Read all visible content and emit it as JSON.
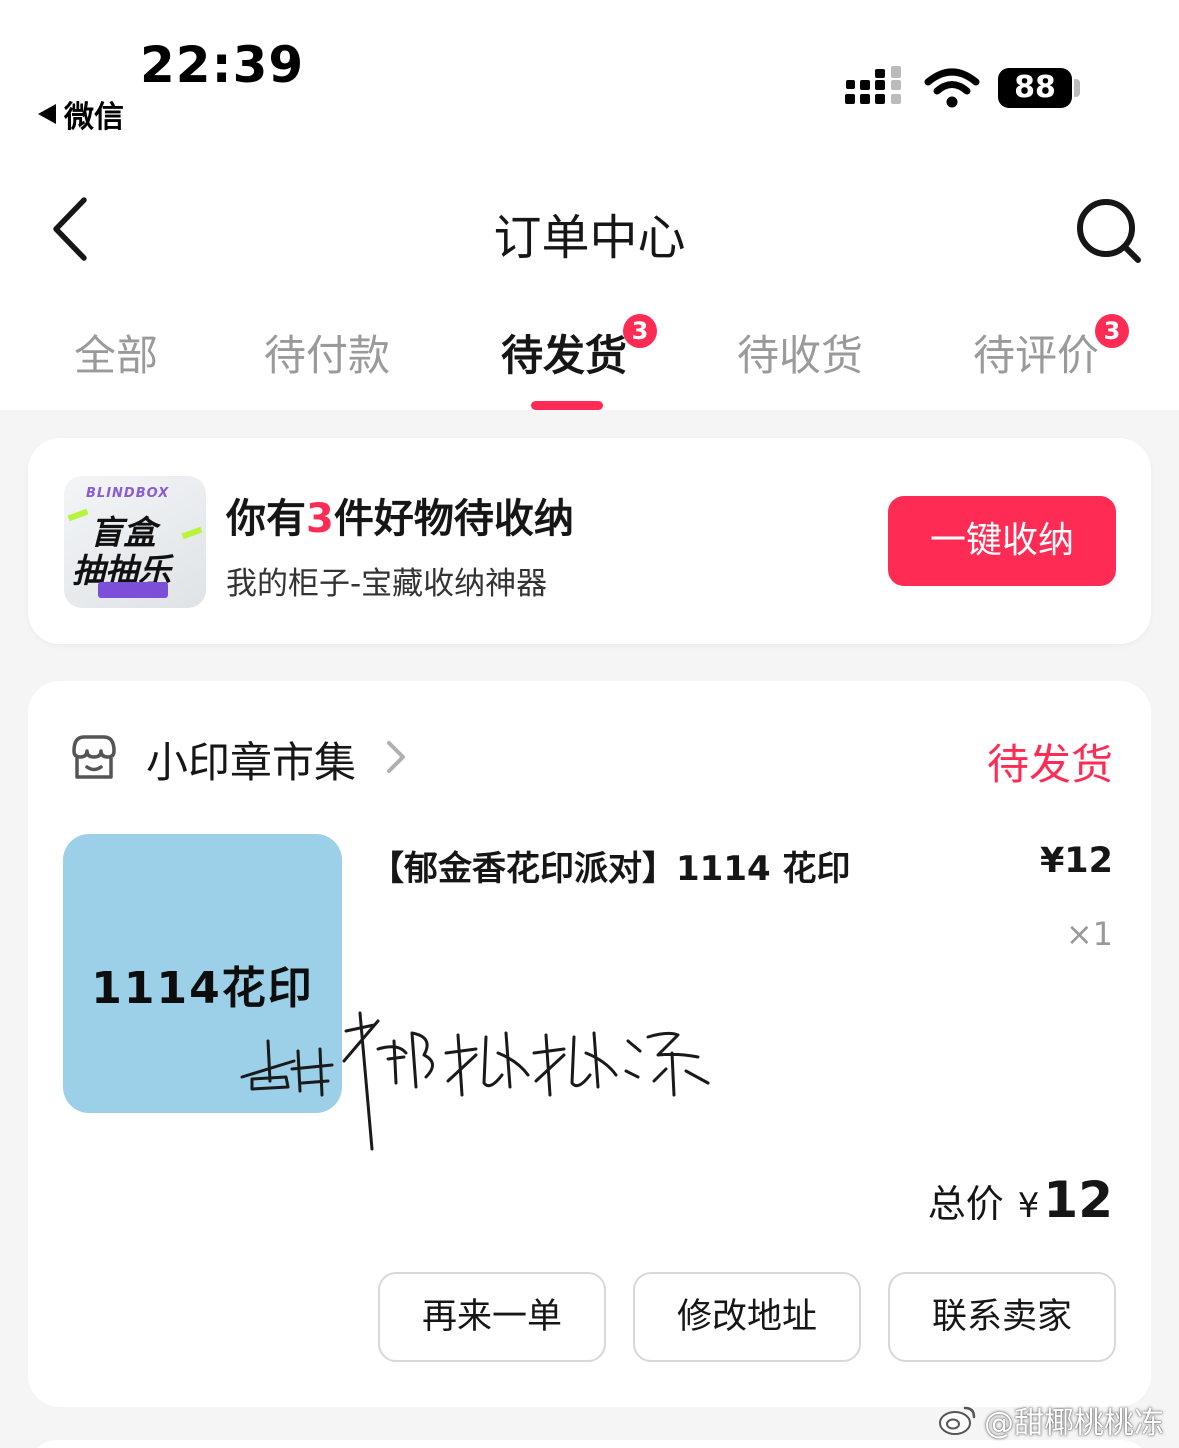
{
  "status_bar": {
    "time": "22:39",
    "back_app": "微信",
    "battery": "88"
  },
  "nav": {
    "title": "订单中心",
    "back_icon": "chevron-left-icon",
    "search_icon": "search-icon"
  },
  "tabs": [
    {
      "label": "全部",
      "badge": null,
      "active": false
    },
    {
      "label": "待付款",
      "badge": null,
      "active": false
    },
    {
      "label": "待发货",
      "badge": "3",
      "active": true
    },
    {
      "label": "待收货",
      "badge": null,
      "active": false
    },
    {
      "label": "待评价",
      "badge": "3",
      "active": false
    }
  ],
  "promo": {
    "logo_brand": "BLINDBOX",
    "logo_line1": "盲盒",
    "logo_line2": "抽抽乐",
    "title_pre": "你有",
    "title_num": "3",
    "title_post": "件好物待收纳",
    "subtitle": "我的柜子-宝藏收纳神器",
    "button": "一键收纳"
  },
  "order": {
    "shop_name": "小印章市集",
    "status": "待发货",
    "product_image_text": "1114花印",
    "product_title": "【郁金香花印派对】1114 花印",
    "price": "¥12",
    "quantity": "×1",
    "total_label": "总价",
    "total_currency": "¥",
    "total_amount": "12",
    "buttons": [
      "再来一单",
      "修改地址",
      "联系卖家"
    ]
  },
  "signature_text": "甜椰桃桃冻",
  "watermark": "@甜椰桃桃冻",
  "colors": {
    "accent": "#fe2c55",
    "product_bg": "#9bd0e8",
    "page_bg": "#f5f5f5"
  }
}
